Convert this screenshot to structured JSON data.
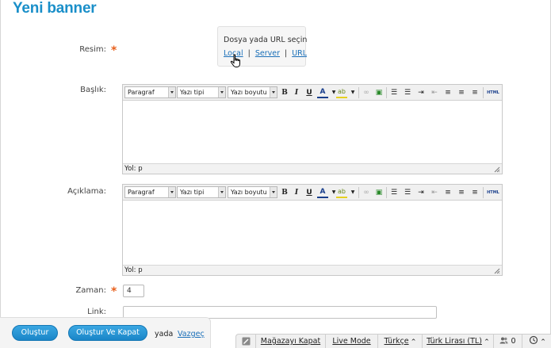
{
  "page": {
    "title": "Yeni banner"
  },
  "form": {
    "image": {
      "label": "Resim:",
      "required_mark": "*",
      "picker_title": "Dosya yada URL seçin",
      "options": [
        "Local",
        "Server",
        "URL"
      ],
      "separator": "|"
    },
    "title": {
      "label": "Başlık:",
      "toolbar": {
        "format": "Paragraf",
        "font": "Yazı tipi",
        "size": "Yazı boyutu"
      },
      "path": "Yol: p"
    },
    "description": {
      "label": "Açıklama:",
      "toolbar": {
        "format": "Paragraf",
        "font": "Yazı tipi",
        "size": "Yazı boyutu"
      },
      "path": "Yol: p"
    },
    "time": {
      "label": "Zaman:",
      "required_mark": "*",
      "value": "4"
    },
    "link": {
      "label": "Link:",
      "value": ""
    }
  },
  "actions": {
    "create": "Oluştur",
    "create_close": "Oluştur Ve Kapat",
    "or": "yada",
    "cancel": "Vazgeç"
  },
  "statusbar": {
    "close_store": "Mağazayı Kapat",
    "live_mode": "Live Mode",
    "language": "Türkçe",
    "currency": "Türk Lirası (TL)",
    "users_count": "0"
  },
  "colors": {
    "accent": "#1a8fc9",
    "required": "#e8601c",
    "link": "#1a6fb8"
  }
}
